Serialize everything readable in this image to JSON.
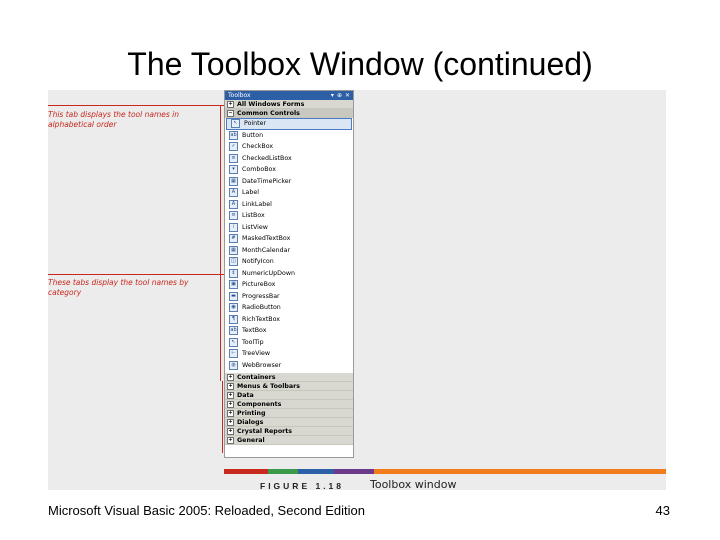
{
  "slide": {
    "title": "The Toolbox Window (continued)",
    "footer": "Microsoft Visual Basic 2005: Reloaded, Second Edition",
    "page_number": "43"
  },
  "figure": {
    "callout_top": "This tab displays the tool names in alphabetical order",
    "callout_bottom": "These tabs display the tool names by category",
    "label": "FIGURE 1.18",
    "caption": "Toolbox window",
    "colors": {
      "callout": "#c8281e",
      "toolbox_title": "#2d5fa6",
      "band": "#f07c1c"
    },
    "toolbox": {
      "title": "Toolbox",
      "controls": [
        "▾",
        "⊕",
        "✕"
      ],
      "tab_all": "All Windows Forms",
      "tab_common": "Common Controls",
      "items": [
        {
          "label": "Pointer",
          "icon": "pointer-icon"
        },
        {
          "label": "Button",
          "icon": "button-icon"
        },
        {
          "label": "CheckBox",
          "icon": "checkbox-icon"
        },
        {
          "label": "CheckedListBox",
          "icon": "checkedlistbox-icon"
        },
        {
          "label": "ComboBox",
          "icon": "combobox-icon"
        },
        {
          "label": "DateTimePicker",
          "icon": "datetimepicker-icon"
        },
        {
          "label": "Label",
          "icon": "label-icon"
        },
        {
          "label": "LinkLabel",
          "icon": "linklabel-icon"
        },
        {
          "label": "ListBox",
          "icon": "listbox-icon"
        },
        {
          "label": "ListView",
          "icon": "listview-icon"
        },
        {
          "label": "MaskedTextBox",
          "icon": "maskedtextbox-icon"
        },
        {
          "label": "MonthCalendar",
          "icon": "monthcalendar-icon"
        },
        {
          "label": "NotifyIcon",
          "icon": "notifyicon-icon"
        },
        {
          "label": "NumericUpDown",
          "icon": "numericupdown-icon"
        },
        {
          "label": "PictureBox",
          "icon": "picturebox-icon"
        },
        {
          "label": "ProgressBar",
          "icon": "progressbar-icon"
        },
        {
          "label": "RadioButton",
          "icon": "radiobutton-icon"
        },
        {
          "label": "RichTextBox",
          "icon": "richtextbox-icon"
        },
        {
          "label": "TextBox",
          "icon": "textbox-icon"
        },
        {
          "label": "ToolTip",
          "icon": "tooltip-icon"
        },
        {
          "label": "TreeView",
          "icon": "treeview-icon"
        },
        {
          "label": "WebBrowser",
          "icon": "webbrowser-icon"
        }
      ],
      "category_tabs": [
        "Containers",
        "Menus & Toolbars",
        "Data",
        "Components",
        "Printing",
        "Dialogs",
        "Crystal Reports",
        "General"
      ]
    }
  }
}
